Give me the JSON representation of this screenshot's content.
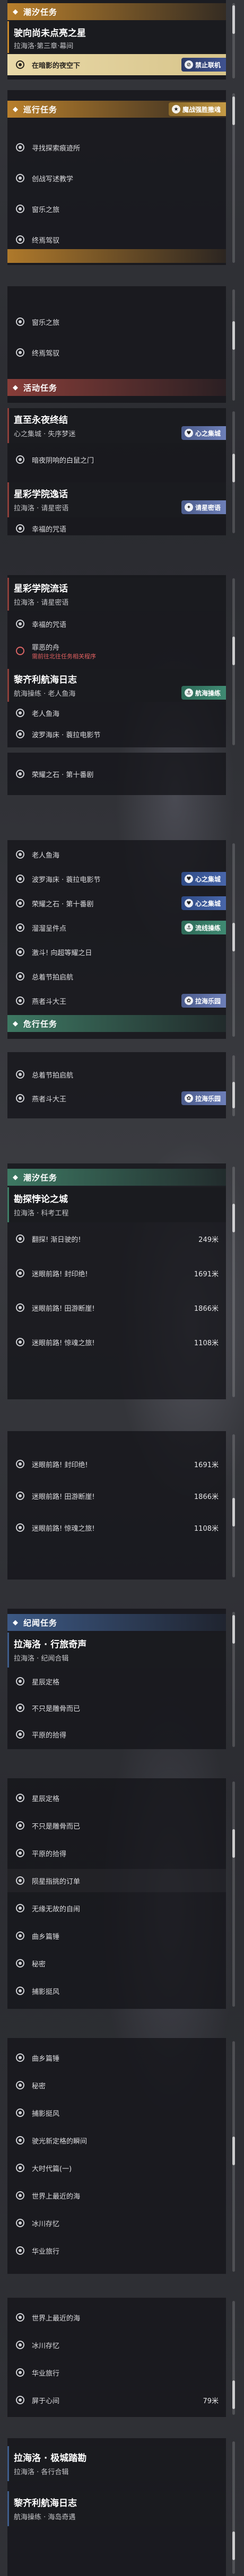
{
  "sections": {
    "main": "潮汐任务",
    "world": "巡行任务",
    "event": "活动任务",
    "emergency": "危行任务",
    "tidal": "潮汐任务",
    "story": "纪闻任务"
  },
  "quests": {
    "q1": {
      "title": "驶向尚未点亮之星",
      "subtitle": "拉海洛·第三章·幕间",
      "obj1": "在暗影的夜空下",
      "tag": "禁止联机"
    },
    "world_objs": [
      "寻找探索痕迹所",
      "创战写述教学",
      "窗乐之旅",
      "终焉驾驭"
    ],
    "world_tag": "魔战强胜撒魂",
    "world2_objs": [
      "窗乐之旅",
      "终焉驾驭"
    ],
    "q2": {
      "title": "直至永夜终结",
      "subtitle": "心之集城 · 失序梦迷",
      "obj1": "暗夜阴响的白鼠之门",
      "tag": "心之集城"
    },
    "q3": {
      "title": "星彩学院逸话",
      "subtitle": "拉海洛 · 请星密语",
      "obj1": "幸福的咒语",
      "tag": "请星密语"
    },
    "q4": {
      "title": "星彩学院流话",
      "subtitle": "拉海洛 · 请星密语",
      "obj1": "幸福的咒语",
      "obj2": "罪恶的舟",
      "obj2b": "需前往北往任务相关程序",
      "tag": "请星密语"
    },
    "q5": {
      "title": "黎齐利航海日志",
      "subtitle": "航海操练 · 老人鱼海",
      "tag": "航海操练",
      "objs": [
        "老人鱼海",
        "波罗海床 · 蓑拉电影节",
        "荣耀之石 · 第十番剧"
      ]
    },
    "q5b_objs": [
      "老人鱼海",
      "波罗海床 · 蓑拉电影节",
      "荣耀之石 · 第十番剧",
      "溜溜呈件点",
      "激斗! 向超等耀之日",
      "总着节拍启航",
      "燕者斗大王"
    ],
    "q5b_tags": [
      "心之集城",
      "心之集城",
      "流线操练",
      "拉海乐园"
    ],
    "q6_objs": [
      "总着节拍启航",
      "燕者斗大王"
    ],
    "q6_tag": "拉海乐园",
    "q7": {
      "title": "勘探悖论之城",
      "subtitle": "拉海洛 · 科考工程",
      "rows": [
        [
          "翻探! 渐日驶的!",
          "249米"
        ],
        [
          "迷眼前路! 封印绝!",
          "1691米"
        ],
        [
          "迷眼前路! 田游断崖!",
          "1866米"
        ],
        [
          "迷眼前路! 惊魂之旅!",
          "1108米"
        ]
      ]
    },
    "q7b_rows": [
      [
        "迷眼前路! 封印绝!",
        "1691米"
      ],
      [
        "迷眼前路! 田游断崖!",
        "1866米"
      ],
      [
        "迷眼前路! 惊魂之旅!",
        "1108米"
      ]
    ],
    "q8": {
      "title": "拉海洛 · 行旅奇声",
      "subtitle": "拉海洛 · 纪闻合辑",
      "objs": [
        "星辰定格",
        "不只是雕骨而已",
        "平原的拾得"
      ]
    },
    "q8b_objs": [
      "星辰定格",
      "不只是雕骨而已",
      "平原的拾得",
      "陨星指挑的订单",
      "无缘无故的自闹",
      "曲乡篇锤",
      "秘密",
      "捕影挺风"
    ],
    "q8c_objs": [
      "曲乡篇锤",
      "秘密",
      "捕影挺风",
      "驶光新定格的瞬间",
      "大时代篇(一)",
      "世界上最近的海",
      "冰川存忆",
      "华业旅行"
    ],
    "q8d_objs": [
      "世界上最近的海",
      "冰川存忆",
      "华业旅行"
    ],
    "q8d_last": {
      "text": "屏于心间",
      "dist": "79米"
    },
    "q9": {
      "title": "拉海洛 · 极城踏勘",
      "subtitle": "拉海洛 · 各行合辑"
    },
    "q10": {
      "title": "黎齐利航海日志",
      "subtitle": "航海操练 · 海岛奇遇"
    }
  },
  "colors": {
    "main_sec": "#c98a2d",
    "world_sec": "#c98a2d",
    "event_sec": "#8d3f3a",
    "emergency_sec": "#3f7d66",
    "tidal_sec": "#3f7d66",
    "story_sec": "#3e5c8a"
  }
}
